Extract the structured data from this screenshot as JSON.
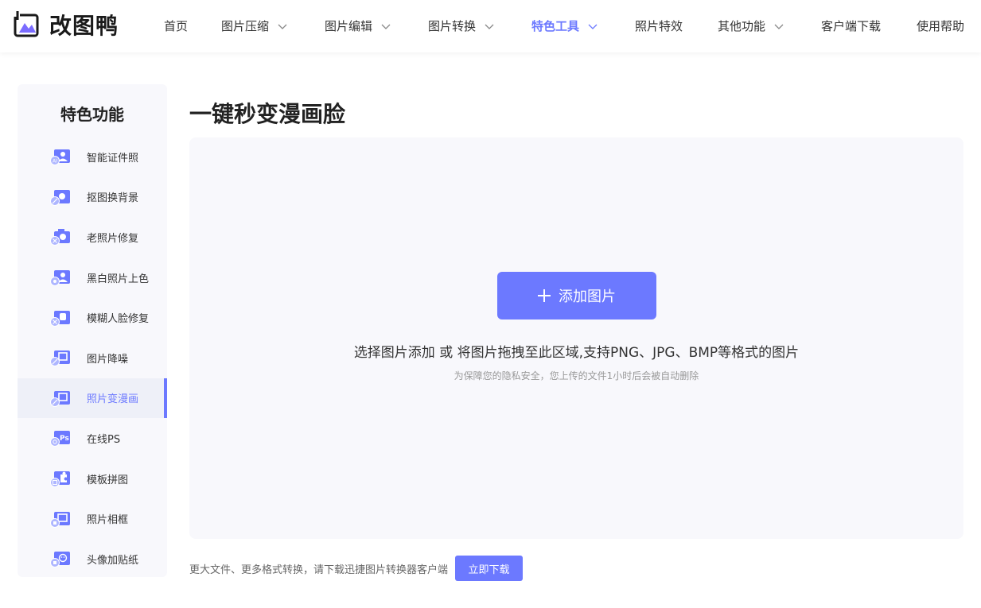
{
  "brand": {
    "name": "改图鸭",
    "accent": "#6c79ff"
  },
  "nav": [
    {
      "label": "首页",
      "dropdown": false,
      "active": false
    },
    {
      "label": "图片压缩",
      "dropdown": true,
      "active": false
    },
    {
      "label": "图片编辑",
      "dropdown": true,
      "active": false
    },
    {
      "label": "图片转换",
      "dropdown": true,
      "active": false
    },
    {
      "label": "特色工具",
      "dropdown": true,
      "active": true
    },
    {
      "label": "照片特效",
      "dropdown": false,
      "active": false
    },
    {
      "label": "其他功能",
      "dropdown": true,
      "active": false
    },
    {
      "label": "客户端下载",
      "dropdown": false,
      "active": false
    },
    {
      "label": "使用帮助",
      "dropdown": false,
      "active": false
    }
  ],
  "sidebar": {
    "title": "特色功能",
    "items": [
      {
        "label": "智能证件照",
        "icon": "id-photo-icon",
        "active": false
      },
      {
        "label": "抠图换背景",
        "icon": "cutout-icon",
        "active": false
      },
      {
        "label": "老照片修复",
        "icon": "camera-repair-icon",
        "active": false
      },
      {
        "label": "黑白照片上色",
        "icon": "colorize-icon",
        "active": false
      },
      {
        "label": "模糊人脸修复",
        "icon": "face-repair-icon",
        "active": false
      },
      {
        "label": "图片降噪",
        "icon": "denoise-icon",
        "active": false
      },
      {
        "label": "照片变漫画",
        "icon": "cartoon-icon",
        "active": true
      },
      {
        "label": "在线PS",
        "icon": "ps-icon",
        "active": false
      },
      {
        "label": "模板拼图",
        "icon": "collage-icon",
        "active": false
      },
      {
        "label": "照片相框",
        "icon": "frame-icon",
        "active": false
      },
      {
        "label": "头像加贴纸",
        "icon": "sticker-icon",
        "active": false
      }
    ]
  },
  "main": {
    "title": "一键秒变漫画脸",
    "add_button": "添加图片",
    "hint": "选择图片添加 或 将图片拖拽至此区域,支持PNG、JPG、BMP等格式的图片",
    "privacy_note": "为保障您的隐私安全，您上传的文件1小时后会被自动删除"
  },
  "footer": {
    "text": "更大文件、更多格式转换，请下载迅捷图片转换器客户端",
    "download_button": "立即下载"
  }
}
